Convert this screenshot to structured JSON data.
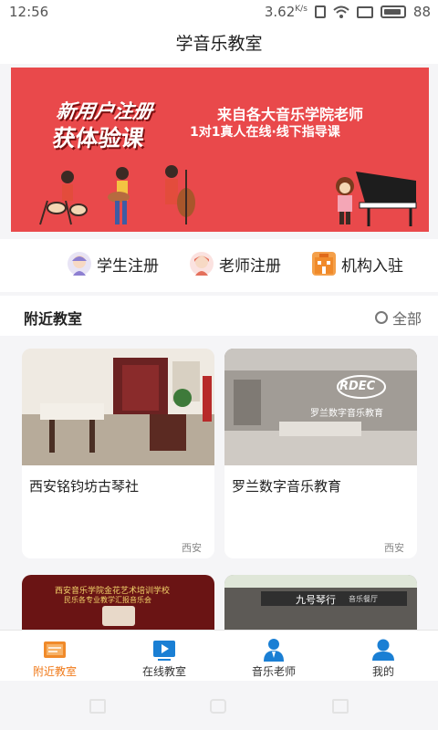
{
  "status_bar": {
    "time": "12:56",
    "net_speed": "3.62",
    "net_unit": "K/s",
    "battery": "88"
  },
  "header": {
    "title": "学音乐教室"
  },
  "banner": {
    "tag_line1": "新用户注册",
    "tag_line2": "获体验课",
    "sub_line1": "来自各大音乐学院老师",
    "sub_line2": "1对1真人在线·线下指导课"
  },
  "entries": [
    {
      "label": "学生注册",
      "icon": "student-icon"
    },
    {
      "label": "老师注册",
      "icon": "teacher-icon"
    },
    {
      "label": "机构入驻",
      "icon": "building-icon"
    }
  ],
  "nearby": {
    "title": "附近教室",
    "all_label": "全部",
    "cards": [
      {
        "name": "西安铭钧坊古琴社",
        "city": "西安"
      },
      {
        "name": "罗兰数字音乐教育",
        "city": "西安",
        "photo_logo": "RDEC",
        "photo_caption": "罗兰数字音乐教育"
      },
      {
        "name": "",
        "city": "",
        "photo_caption_1": "西安音乐学院金花艺术培训学校",
        "photo_caption_2": "民乐各专业教学汇报音乐会"
      },
      {
        "name": "",
        "city": "",
        "photo_caption": "九号琴行",
        "photo_sub": "音乐餐厅"
      }
    ]
  },
  "tabbar": {
    "tabs": [
      {
        "label": "附近教室",
        "active": true
      },
      {
        "label": "在线教室",
        "active": false
      },
      {
        "label": "音乐老师",
        "active": false
      },
      {
        "label": "我的",
        "active": false
      }
    ]
  },
  "colors": {
    "accent": "#f07a1a",
    "banner_bg": "#e9494b",
    "tab_icon": "#1a7fd4"
  }
}
